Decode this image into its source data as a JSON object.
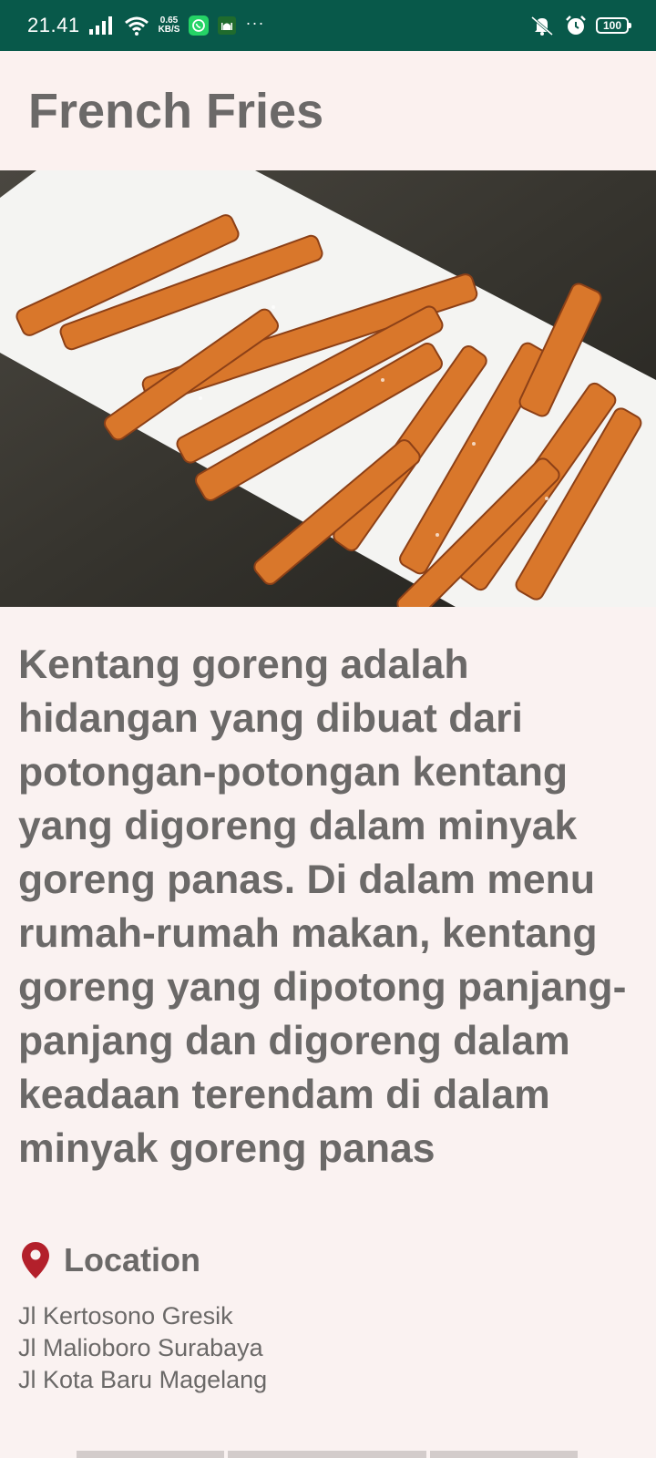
{
  "status_bar": {
    "time": "21.41",
    "net_speed_value": "0.65",
    "net_speed_unit": "KB/S",
    "more": "···",
    "battery": "100"
  },
  "app_bar": {
    "title": "French Fries"
  },
  "detail": {
    "image": "french-fries-photo",
    "description": "Kentang goreng adalah hidangan yang dibuat dari potongan-potongan kentang yang digoreng dalam minyak goreng panas. Di dalam menu rumah-rumah makan, kentang goreng yang dipotong panjang-panjang dan digoreng dalam keadaan terendam di dalam minyak goreng panas",
    "location_title": "Location",
    "locations": [
      "Jl Kertosono Gresik",
      "Jl Malioboro Surabaya",
      "Jl Kota Baru Magelang"
    ]
  },
  "colors": {
    "status_bar": "#08594a",
    "background": "#faf2f1",
    "text": "#6b6968",
    "pin": "#b3202b"
  }
}
